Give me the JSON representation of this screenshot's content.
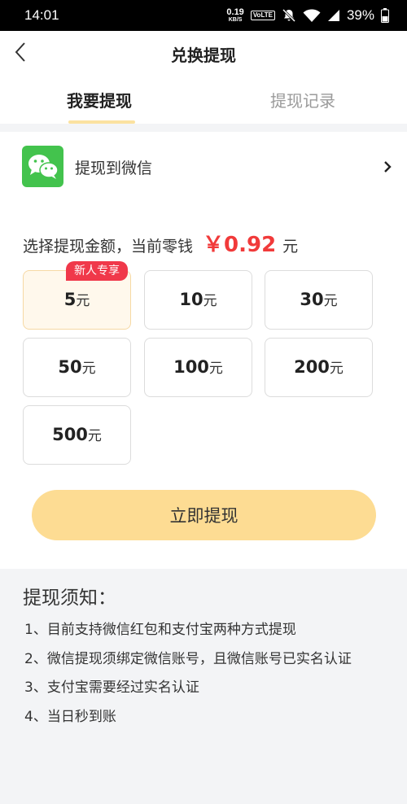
{
  "status_bar": {
    "time": "14:01",
    "net_speed_value": "0.19",
    "net_speed_unit": "KB/S",
    "volte": "VoLTE",
    "battery": "39%"
  },
  "header": {
    "title": "兑换提现"
  },
  "tabs": [
    {
      "label": "我要提现",
      "active": true
    },
    {
      "label": "提现记录",
      "active": false
    }
  ],
  "payout_method": {
    "label": "提现到微信",
    "icon": "wechat-icon"
  },
  "amount_line": {
    "prefix": "选择提现金额，当前零钱",
    "value": "￥0.92",
    "unit": "元"
  },
  "amount_options": [
    {
      "value": "5",
      "unit": "元",
      "selected": true,
      "badge": "新人专享"
    },
    {
      "value": "10",
      "unit": "元",
      "selected": false
    },
    {
      "value": "30",
      "unit": "元",
      "selected": false
    },
    {
      "value": "50",
      "unit": "元",
      "selected": false
    },
    {
      "value": "100",
      "unit": "元",
      "selected": false
    },
    {
      "value": "200",
      "unit": "元",
      "selected": false
    },
    {
      "value": "500",
      "unit": "元",
      "selected": false
    }
  ],
  "withdraw_button": {
    "label": "立即提现"
  },
  "notice": {
    "title": "提现须知：",
    "items": [
      "1、目前支持微信红包和支付宝两种方式提现",
      "2、微信提现须绑定微信账号，且微信账号已实名认证",
      "3、支付宝需要经过实名认证",
      "4、当日秒到账"
    ]
  },
  "colors": {
    "accent_yellow": "#fddc93",
    "price_red": "#f13a3a",
    "badge_red": "#f0384a",
    "wechat_green": "#43c34d"
  }
}
